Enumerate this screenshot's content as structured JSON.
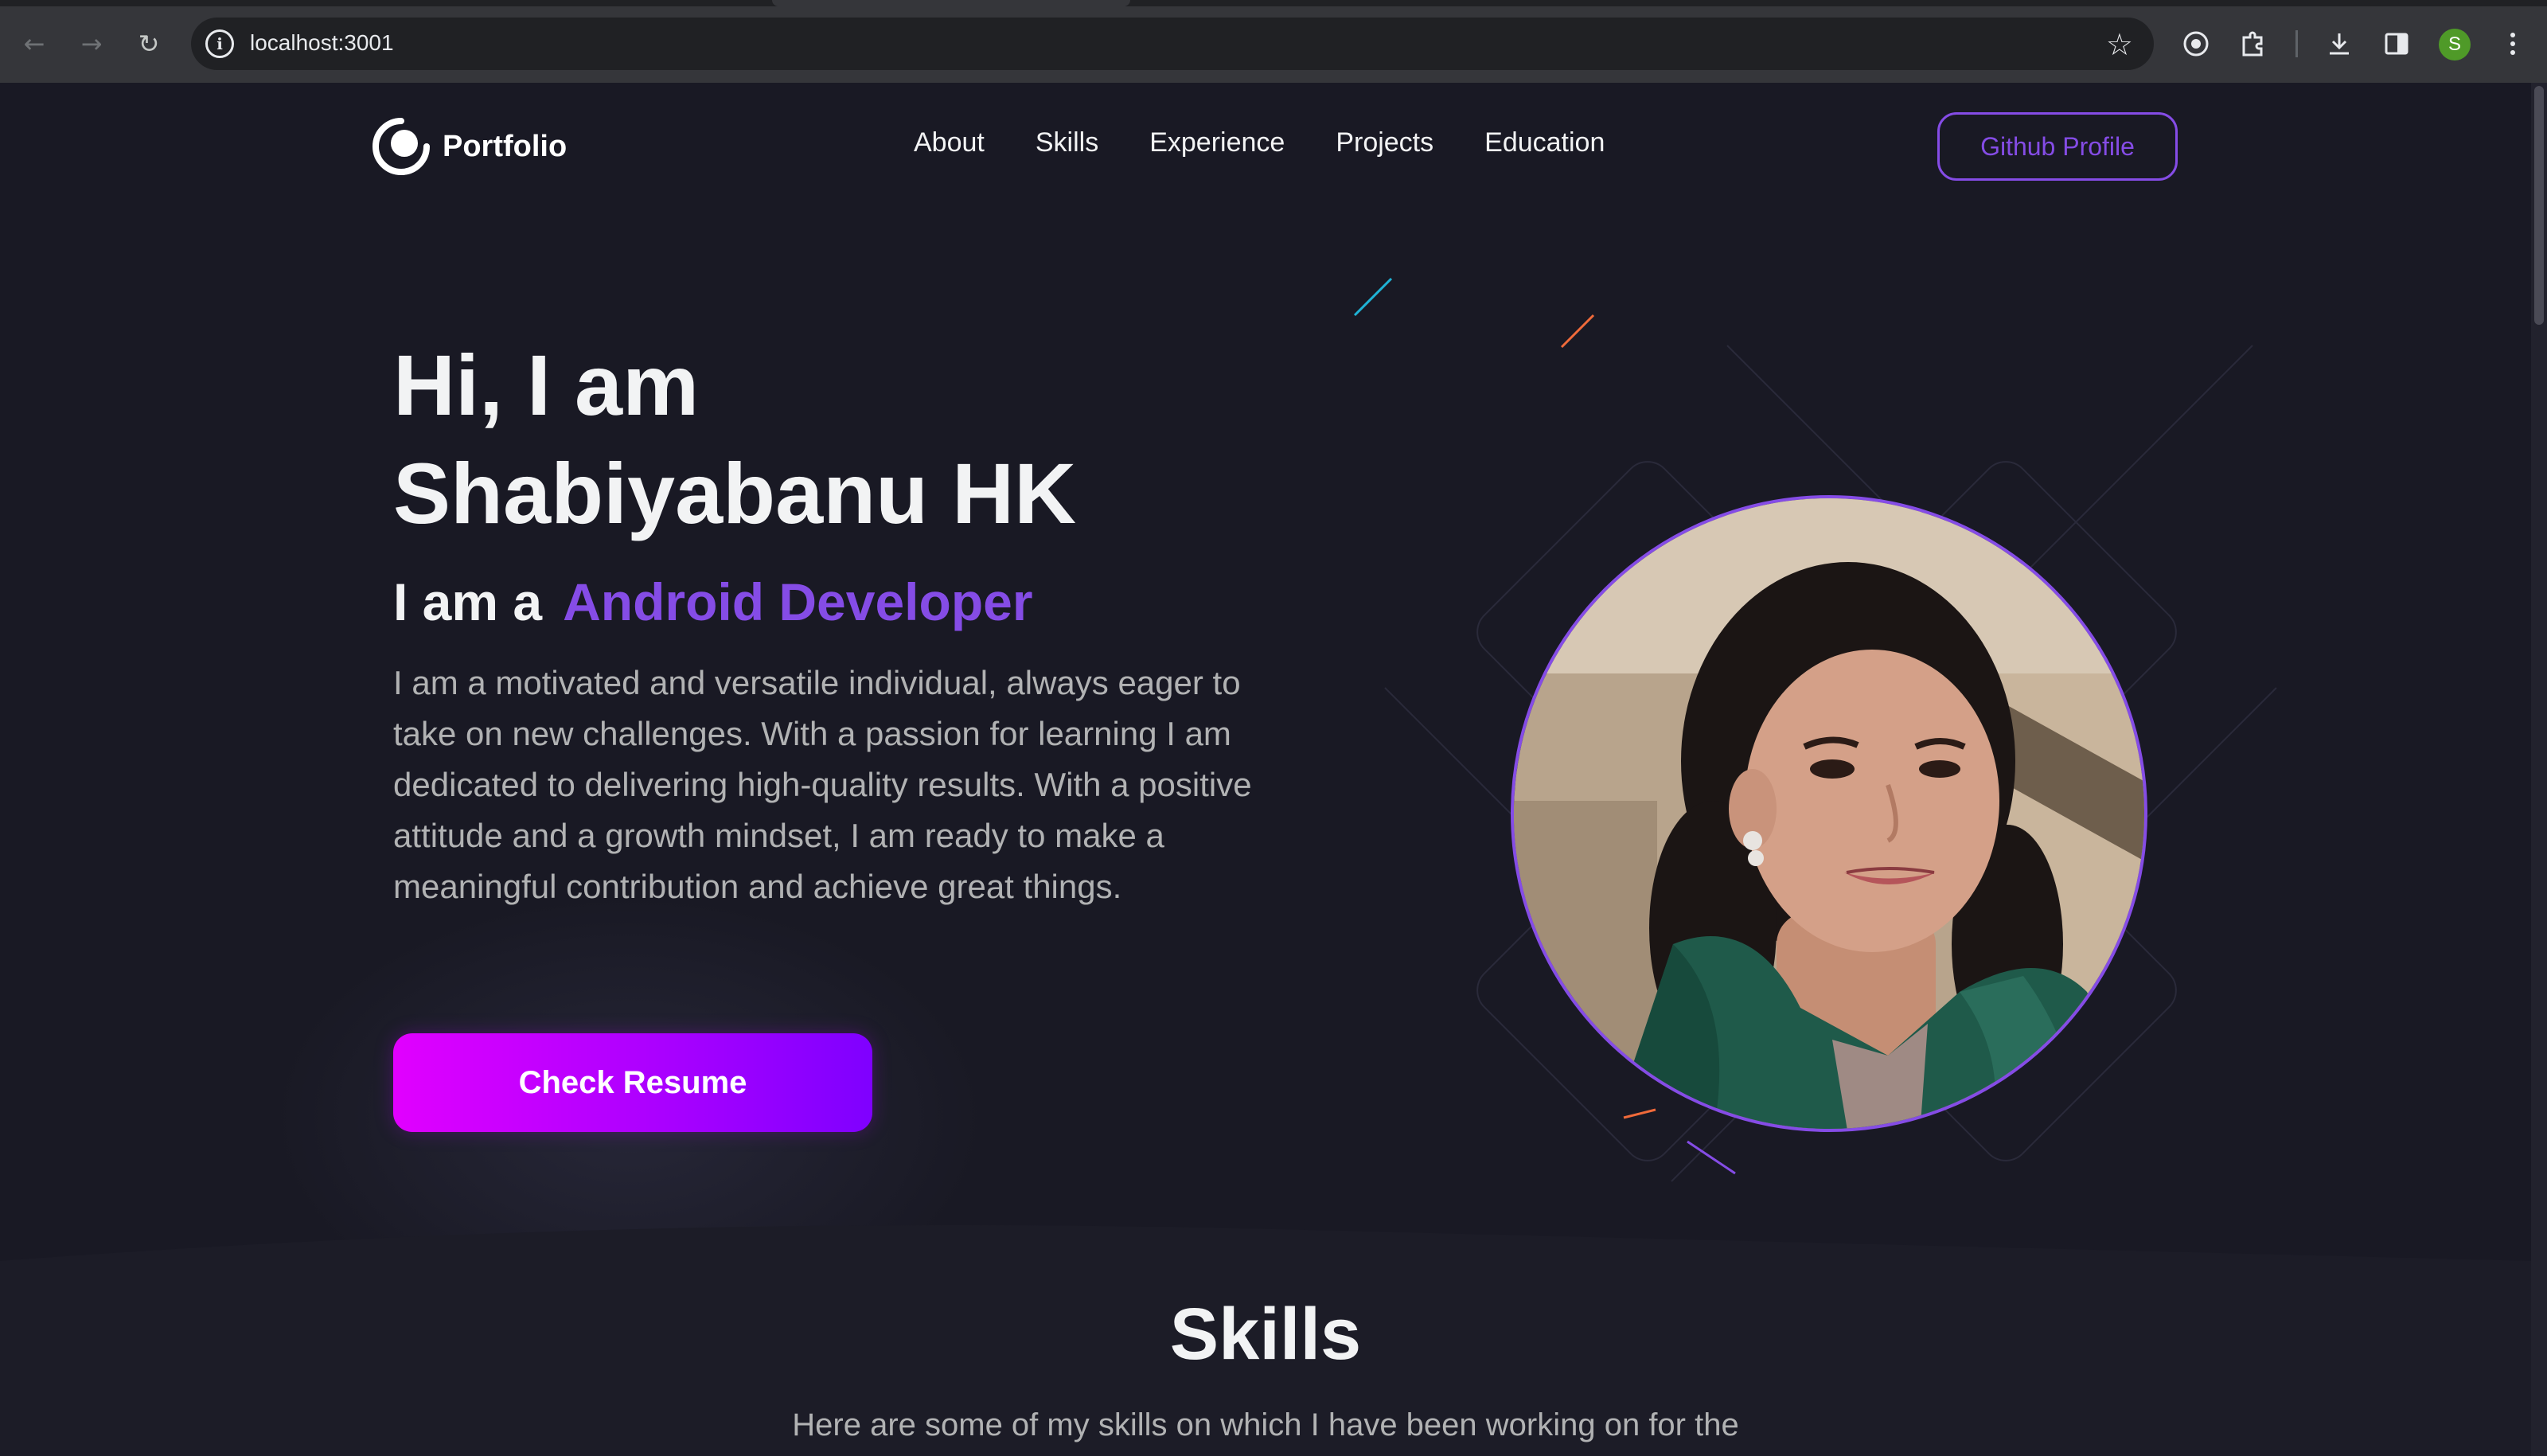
{
  "browser": {
    "url": "localhost:3001",
    "profile_initial": "S",
    "icons": [
      "back-icon",
      "forward-icon",
      "reload-icon",
      "site-info-icon",
      "bookmark-star-icon",
      "extension-target-icon",
      "extensions-puzzle-icon",
      "download-icon",
      "side-panel-icon",
      "menu-dots-icon"
    ]
  },
  "navbar": {
    "logo_text": "Portfolio",
    "links": [
      "About",
      "Skills",
      "Experience",
      "Projects",
      "Education"
    ],
    "github_label": "Github Profile"
  },
  "hero": {
    "title_line1": "Hi, I am",
    "title_line2": "Shabiyabanu HK",
    "role_prefix": "I am a",
    "role": "Android Developer",
    "description": "I am a motivated and versatile individual, always eager to take on new challenges. With a passion for learning I am dedicated to delivering high-quality results. With a positive attitude and a growth mindset, I am ready to make a meaningful contribution and achieve great things.",
    "button_label": "Check Resume"
  },
  "skills": {
    "title": "Skills",
    "description": "Here are some of my skills on which I have been working on for the"
  },
  "colors": {
    "accent": "#854ce6",
    "background": "#191924",
    "resume_gradient_start": "#e100ff",
    "resume_gradient_end": "#7f00ff"
  }
}
